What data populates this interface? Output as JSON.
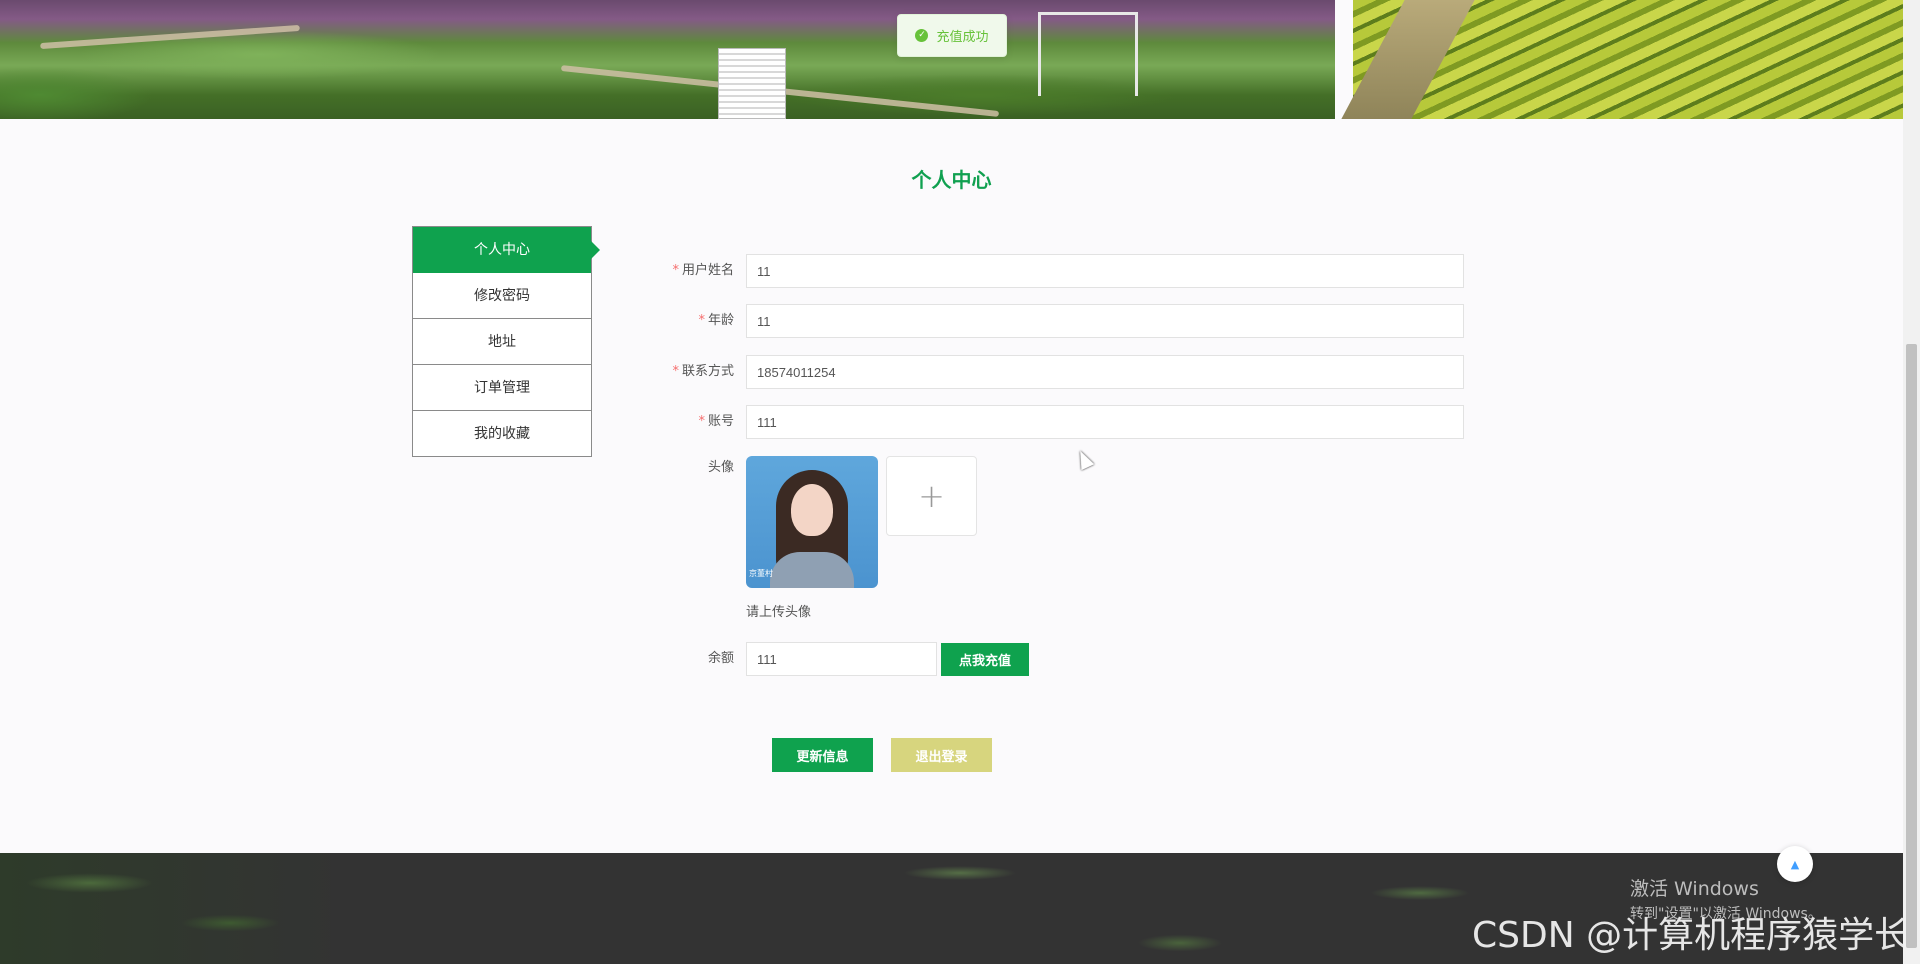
{
  "toast": {
    "message": "充值成功"
  },
  "page_title": "个人中心",
  "side_menu": {
    "items": [
      {
        "label": "个人中心",
        "active": true
      },
      {
        "label": "修改密码",
        "active": false
      },
      {
        "label": "地址",
        "active": false
      },
      {
        "label": "订单管理",
        "active": false
      },
      {
        "label": "我的收藏",
        "active": false
      }
    ]
  },
  "form": {
    "username": {
      "label": "用户姓名",
      "value": "11",
      "required": true
    },
    "age": {
      "label": "年龄",
      "value": "11",
      "required": true
    },
    "phone": {
      "label": "联系方式",
      "value": "18574011254",
      "required": true
    },
    "account": {
      "label": "账号",
      "value": "111",
      "required": true
    },
    "avatar": {
      "label": "头像",
      "hint": "请上传头像",
      "upload_icon": "+",
      "image_caption": "京董村"
    },
    "balance": {
      "label": "余额",
      "value": "111",
      "recharge_label": "点我充值"
    }
  },
  "actions": {
    "update_label": "更新信息",
    "logout_label": "退出登录"
  },
  "footer": {
    "back_to_top_icon": "▲",
    "activate_line1": "激活 Windows",
    "activate_line2": "转到\"设置\"以激活 Windows。",
    "watermark": "CSDN @计算机程序猿学长"
  },
  "colors": {
    "primary": "#0fa24e",
    "logout": "#d7d57e",
    "toast_success": "#67c23a",
    "required": "#f56c6c"
  }
}
